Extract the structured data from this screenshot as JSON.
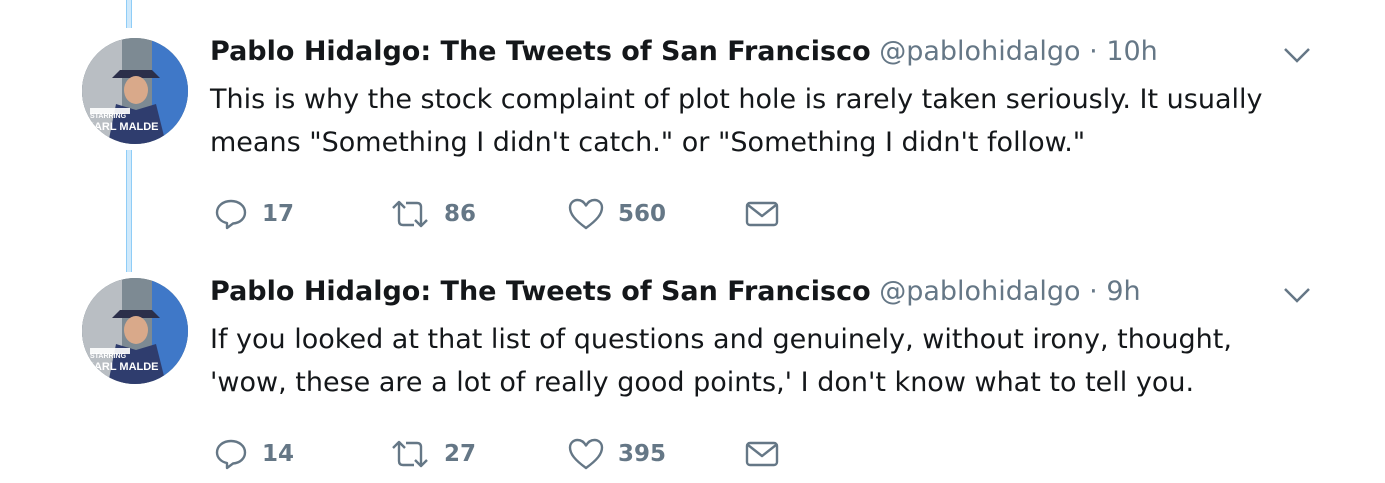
{
  "accent_color": "#1da1f2",
  "muted_color": "#657786",
  "tweets": [
    {
      "author_name": "Pablo Hidalgo: The Tweets of San Francisco",
      "handle": "@pablohidalgo",
      "separator": "·",
      "time": "10h",
      "avatar_caption_top": "STARRING",
      "avatar_caption_bottom": "KARL MALDE",
      "text": "This is why the stock complaint of plot hole is rarely taken seriously. It usually means \"Something I didn't catch.\" or \"Something I didn't follow.\"",
      "replies": "17",
      "retweets": "86",
      "likes": "560"
    },
    {
      "author_name": "Pablo Hidalgo: The Tweets of San Francisco",
      "handle": "@pablohidalgo",
      "separator": "·",
      "time": "9h",
      "avatar_caption_top": "STARRING",
      "avatar_caption_bottom": "KARL MALDE",
      "text": "If you looked at that list of questions and genuinely, without irony, thought, 'wow, these are a lot of really good points,' I don't know what to tell you.",
      "replies": "14",
      "retweets": "27",
      "likes": "395"
    }
  ],
  "icons": {
    "reply": "reply-icon",
    "retweet": "retweet-icon",
    "like": "heart-icon",
    "dm": "envelope-icon",
    "caret": "chevron-down-icon"
  }
}
